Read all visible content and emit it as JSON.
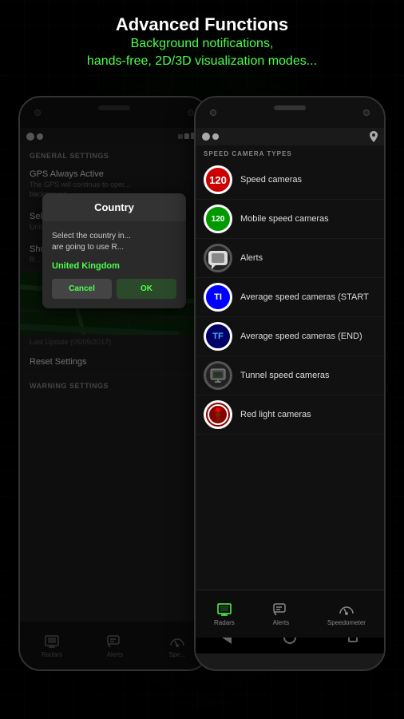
{
  "header": {
    "title": "Advanced Functions",
    "subtitle_line1": "Background notifications,",
    "subtitle_line2": "hands-free, 2D/3D visualization modes..."
  },
  "left_phone": {
    "section_general": "GENERAL SETTINGS",
    "gps_label": "GPS Always Active",
    "gps_sub": "The GPS will continue to oper...",
    "gps_sub2": "background",
    "country_label": "Select your country",
    "country_value": "United Kingdom",
    "show_map_label": "Show Map",
    "show_map_sub": "R...",
    "last_update": "Last Update (05/09/2017)",
    "reset_label": "Reset Settings",
    "warning_header": "WARNING SETTINGS",
    "dialog": {
      "title": "Country",
      "body": "Select the country in...",
      "body2": "are going to use R...",
      "option": "United Kingdom",
      "cancel": "Cancel",
      "confirm": "OK"
    },
    "nav": {
      "radars": "Radars",
      "alerts": "Alerts",
      "speed": "Spe..."
    }
  },
  "right_phone": {
    "section_header": "SPEED CAMERA TYPES",
    "cameras": [
      {
        "id": "speed",
        "label": "Speed cameras",
        "icon_text": "120",
        "icon_type": "speed"
      },
      {
        "id": "mobile",
        "label": "Mobile speed cameras",
        "icon_text": "120",
        "icon_type": "mobile"
      },
      {
        "id": "alert",
        "label": "Alerts",
        "icon_text": "!",
        "icon_type": "alert"
      },
      {
        "id": "avg-start",
        "label": "Average speed cameras (START",
        "icon_text": "TI",
        "icon_type": "avg-start"
      },
      {
        "id": "avg-end",
        "label": "Average speed cameras (END)",
        "icon_text": "TF",
        "icon_type": "avg-end"
      },
      {
        "id": "tunnel",
        "label": "Tunnel speed cameras",
        "icon_text": "",
        "icon_type": "tunnel"
      },
      {
        "id": "red-light",
        "label": "Red light cameras",
        "icon_text": "",
        "icon_type": "red-light"
      }
    ],
    "nav": {
      "radars": "Radars",
      "alerts": "Alerts",
      "speedometer": "Speedometer"
    }
  }
}
